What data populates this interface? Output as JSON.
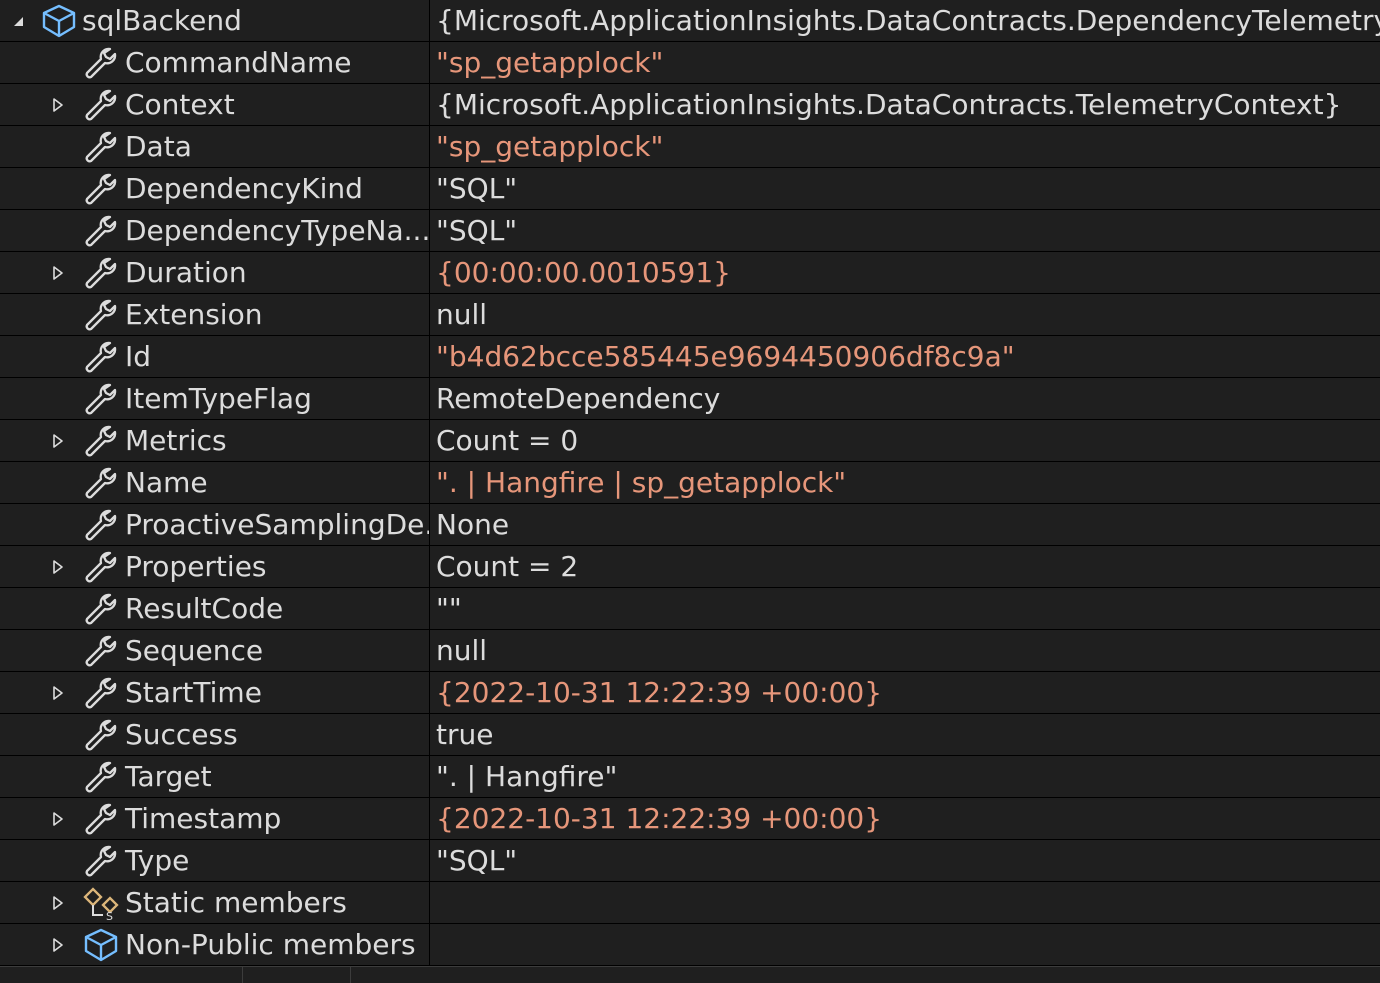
{
  "root": {
    "name": "sqlBackend",
    "value": "{Microsoft.ApplicationInsights.DataContracts.DependencyTelemetry}",
    "icon": "object-cube-icon",
    "expanded": true
  },
  "rows": [
    {
      "name": "CommandName",
      "value": "\"sp_getapplock\"",
      "kind": "string",
      "expandable": false,
      "icon": "wrench-property-icon"
    },
    {
      "name": "Context",
      "value": "{Microsoft.ApplicationInsights.DataContracts.TelemetryContext}",
      "kind": "plain",
      "expandable": true,
      "icon": "wrench-property-icon"
    },
    {
      "name": "Data",
      "value": "\"sp_getapplock\"",
      "kind": "string",
      "expandable": false,
      "icon": "wrench-property-icon"
    },
    {
      "name": "DependencyKind",
      "value": "\"SQL\"",
      "kind": "plain",
      "expandable": false,
      "icon": "wrench-property-icon"
    },
    {
      "name": "DependencyTypeNa...",
      "value": "\"SQL\"",
      "kind": "plain",
      "expandable": false,
      "icon": "wrench-property-icon"
    },
    {
      "name": "Duration",
      "value": "{00:00:00.0010591}",
      "kind": "string",
      "expandable": true,
      "icon": "wrench-property-icon"
    },
    {
      "name": "Extension",
      "value": "null",
      "kind": "plain",
      "expandable": false,
      "icon": "wrench-property-icon"
    },
    {
      "name": "Id",
      "value": "\"b4d62bcce585445e9694450906df8c9a\"",
      "kind": "string",
      "expandable": false,
      "icon": "wrench-property-icon"
    },
    {
      "name": "ItemTypeFlag",
      "value": "RemoteDependency",
      "kind": "plain",
      "expandable": false,
      "icon": "wrench-property-icon"
    },
    {
      "name": "Metrics",
      "value": "Count = 0",
      "kind": "plain",
      "expandable": true,
      "icon": "wrench-property-icon"
    },
    {
      "name": "Name",
      "value": "\". | Hangfire | sp_getapplock\"",
      "kind": "string",
      "expandable": false,
      "icon": "wrench-property-icon"
    },
    {
      "name": "ProactiveSamplingDe...",
      "value": "None",
      "kind": "plain",
      "expandable": false,
      "icon": "wrench-property-icon"
    },
    {
      "name": "Properties",
      "value": "Count = 2",
      "kind": "plain",
      "expandable": true,
      "icon": "wrench-property-icon"
    },
    {
      "name": "ResultCode",
      "value": "\"\"",
      "kind": "plain",
      "expandable": false,
      "icon": "wrench-property-icon"
    },
    {
      "name": "Sequence",
      "value": "null",
      "kind": "plain",
      "expandable": false,
      "icon": "wrench-property-icon"
    },
    {
      "name": "StartTime",
      "value": "{2022-10-31 12:22:39 +00:00}",
      "kind": "string",
      "expandable": true,
      "icon": "wrench-property-icon"
    },
    {
      "name": "Success",
      "value": "true",
      "kind": "plain",
      "expandable": false,
      "icon": "wrench-property-icon"
    },
    {
      "name": "Target",
      "value": "\". | Hangfire\"",
      "kind": "plain",
      "expandable": false,
      "icon": "wrench-property-icon"
    },
    {
      "name": "Timestamp",
      "value": "{2022-10-31 12:22:39 +00:00}",
      "kind": "string",
      "expandable": true,
      "icon": "wrench-property-icon"
    },
    {
      "name": "Type",
      "value": "\"SQL\"",
      "kind": "plain",
      "expandable": false,
      "icon": "wrench-property-icon"
    },
    {
      "name": "Static members",
      "value": "",
      "kind": "plain",
      "expandable": true,
      "icon": "static-members-icon"
    },
    {
      "name": "Non-Public members",
      "value": "",
      "kind": "plain",
      "expandable": true,
      "icon": "object-cube-icon"
    }
  ],
  "colors": {
    "background": "#1f1f1f",
    "text": "#dcdcdc",
    "string_value": "#e6967a",
    "grid_line": "#000000",
    "cube_icon": "#75beff",
    "static_icon": "#dcb67a"
  }
}
